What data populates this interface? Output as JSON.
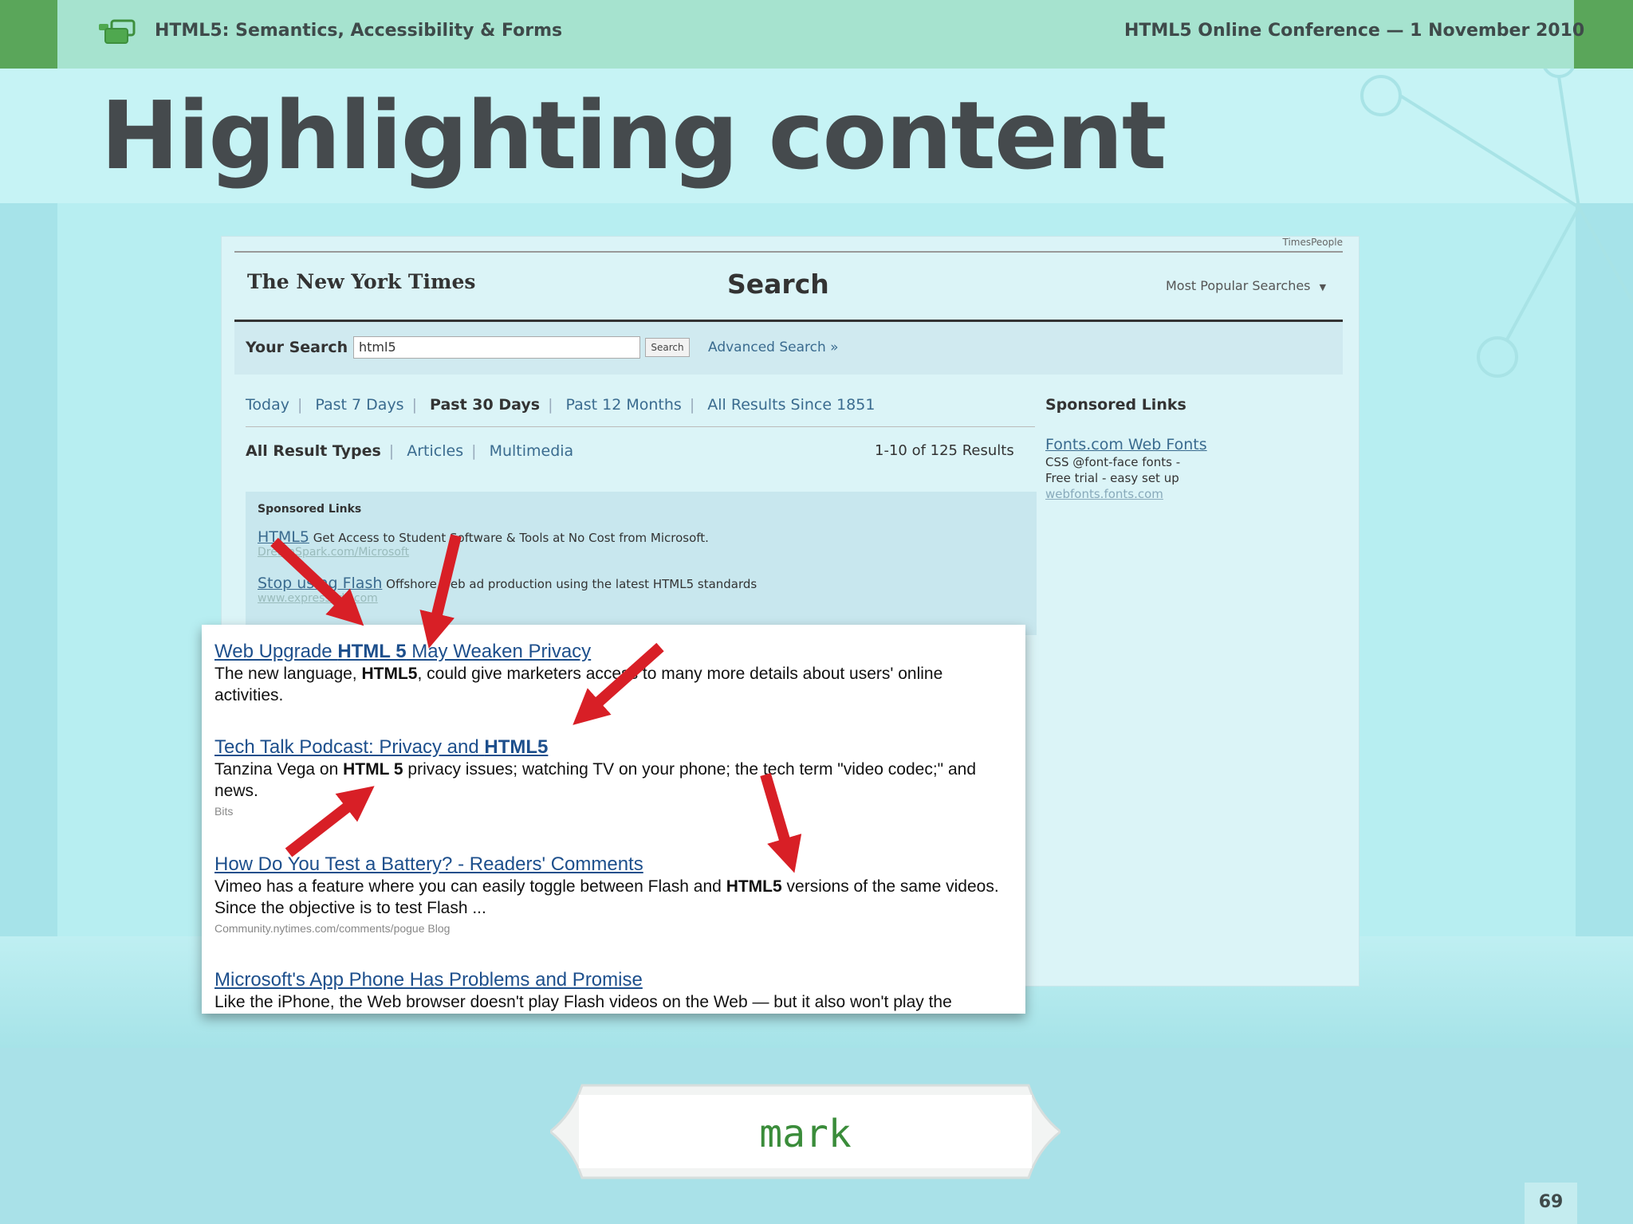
{
  "header": {
    "deck_title": "HTML5: Semantics, Accessibility & Forms",
    "event": "HTML5 Online Conference — 1 November 2010"
  },
  "slide": {
    "title": "Highlighting content",
    "caption": "mark",
    "page_number": "69"
  },
  "nyt": {
    "timespeople": "TimesPeople",
    "logo": "The New York Times",
    "page_title": "Search",
    "most_popular": "Most Popular Searches",
    "your_search_label": "Your Search",
    "search_value": "html5",
    "search_button": "Search",
    "advanced_search": "Advanced Search »",
    "date_filters": [
      "Today",
      "Past 7 Days",
      "Past 30 Days",
      "Past 12 Months",
      "All Results Since 1851"
    ],
    "active_date_filter": "Past 30 Days",
    "type_filters": [
      "All Result Types",
      "Articles",
      "Multimedia"
    ],
    "result_count": "1-10 of 125 Results",
    "sponsored": {
      "heading": "Sponsored Links",
      "ads": [
        {
          "title": "HTML5",
          "text": "Get Access to Student Software & Tools at No Cost from Microsoft.",
          "url": "DreamSpark.com/Microsoft"
        },
        {
          "title": "Stop using Flash",
          "text": "Offshore web ad production using the latest HTML5 standards",
          "url": "www.expressads.com"
        }
      ]
    },
    "sidebar": {
      "heading": "Sponsored Links",
      "ad_title": "Fonts.com Web Fonts",
      "ad_line1": "CSS @font-face fonts -",
      "ad_line2": "Free trial - easy set up",
      "ad_url": "webfonts.fonts.com"
    },
    "results": [
      {
        "title_pre": "Web Upgrade ",
        "title_mark": "HTML 5",
        "title_post": " May Weaken Privacy",
        "snippet_pre": "The new language, ",
        "snippet_mark": "HTML5",
        "snippet_post": ", could give marketers access to many more details about users' online activities.",
        "source": ""
      },
      {
        "title_pre": "Tech Talk Podcast: Privacy and ",
        "title_mark": "HTML5",
        "title_post": "",
        "snippet_pre": "Tanzina Vega on ",
        "snippet_mark": "HTML 5",
        "snippet_post": " privacy issues; watching TV on your phone; the tech term \"video codec;\" and news.",
        "source": "Bits"
      },
      {
        "title_pre": "How Do You Test a Battery? - Readers' Comments",
        "title_mark": "",
        "title_post": "",
        "snippet_pre": "Vimeo has a feature where you can easily toggle between Flash and ",
        "snippet_mark": "HTML5",
        "snippet_post": " versions of the same videos. Since the objective is to test Flash ...",
        "source": "Community.nytimes.com/comments/pogue Blog"
      },
      {
        "title_pre": "Microsoft's App Phone Has Problems and Promise",
        "title_mark": "",
        "title_post": "",
        "snippet_pre": "Like the iPhone, the Web browser doesn't play Flash videos on the Web — but it also won't play the",
        "snippet_mark": "",
        "snippet_post": "",
        "source": ""
      }
    ]
  },
  "colors": {
    "header_bar": "#a6e3cf",
    "header_caps": "#5aa65a",
    "arrow": "#d81f26",
    "title_text": "#454a4d",
    "mark_text": "#3a8c3a"
  },
  "icons": {
    "deck_logo": "speech-bubbles-icon",
    "dropdown": "caret-down-icon",
    "arrows": "red-arrow-icon"
  }
}
